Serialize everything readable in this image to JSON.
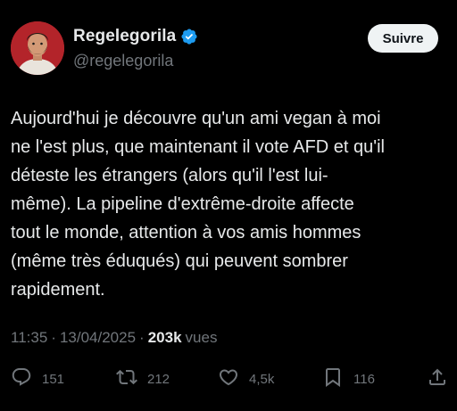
{
  "colors": {
    "background": "#000000",
    "text": "#e7e9ea",
    "muted": "#71767b",
    "verified": "#1d9bf0",
    "follow_bg": "#eff3f4"
  },
  "author": {
    "display_name": "Regelegorila",
    "handle": "@regelegorila",
    "verified": true,
    "verified_icon": "verified-badge-icon"
  },
  "follow_button": {
    "label": "Suivre"
  },
  "tweet": {
    "text": "Aujourd'hui je découvre qu'un ami vegan à moi\nne l'est plus, que maintenant il vote AFD et qu'il\ndéteste les étrangers (alors qu'il l'est lui-\nmême). La pipeline d'extrême-droite affecte\ntout le monde, attention à vos amis hommes\n(même très éduqués) qui peuvent sombrer\nrapidement.",
    "time": "11:35",
    "separator": "·",
    "date": "13/04/2025",
    "views_count": "203k",
    "views_label": "vues"
  },
  "actions": {
    "replies": {
      "icon": "reply-icon",
      "count": "151"
    },
    "retweets": {
      "icon": "retweet-icon",
      "count": "212"
    },
    "likes": {
      "icon": "heart-icon",
      "count": "4,5k"
    },
    "bookmarks": {
      "icon": "bookmark-icon",
      "count": "116"
    },
    "share": {
      "icon": "share-icon"
    }
  }
}
